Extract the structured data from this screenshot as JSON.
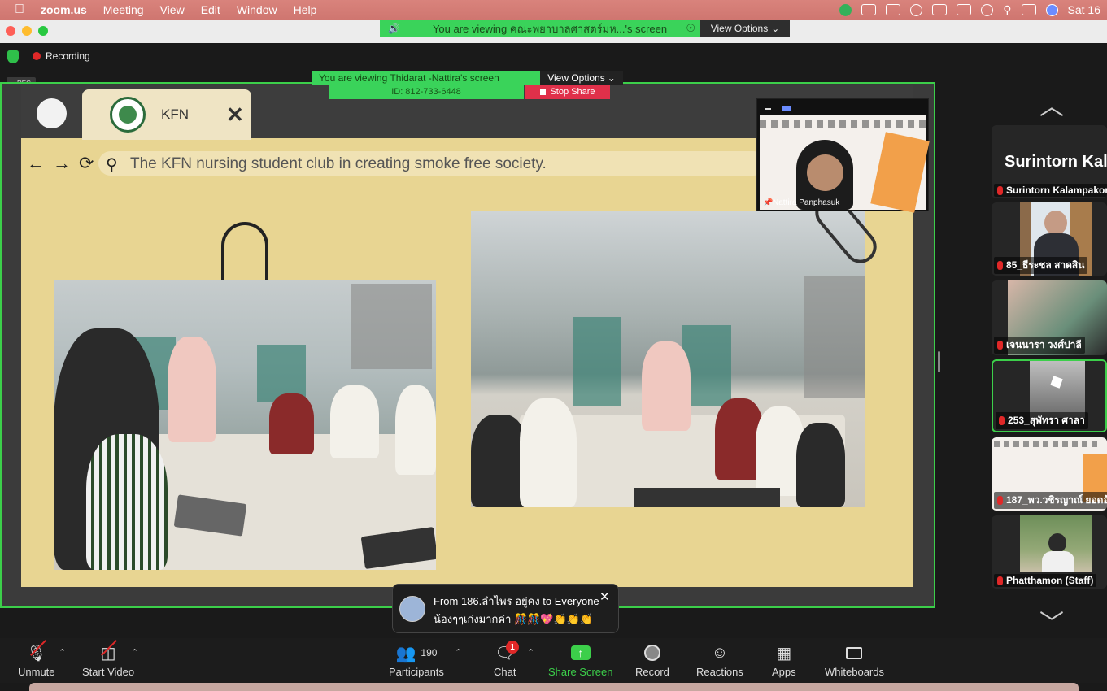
{
  "menubar": {
    "app_name": "zoom.us",
    "items": [
      "Meeting",
      "View",
      "Edit",
      "Window",
      "Help"
    ],
    "clock": "Sat 16"
  },
  "view_banner": {
    "text": "You are viewing คณะพยาบาลศาสตร์มห...'s screen",
    "options_label": "View Options"
  },
  "meeting": {
    "recording_label": "Recording",
    "rec_tag": "REC"
  },
  "shared_screen": {
    "inner_banner": "You are viewing Thidarat -Nattira's screen",
    "inner_options": "View Options",
    "inner_meeting_id": "ID: 812-733-6448",
    "inner_stop_share": "Stop Share",
    "tab_title": "KFN",
    "address_text": "The KFN nursing student club in creating smoke free society."
  },
  "speaker_thumb": {
    "name": "Nattira Panphasuk"
  },
  "participants": {
    "header_name": "Surintorn Kal...",
    "tiles": [
      {
        "name": "Surintorn Kalampakorn"
      },
      {
        "name": "85_ธีระชล สาดสิน"
      },
      {
        "name": "เจนนารา วงศ์ปาลี"
      },
      {
        "name": "253_สุพัทรา ศาลา"
      },
      {
        "name": "187_พว.วชิรญาณ์ ยอดอ้"
      },
      {
        "name": "Phatthamon (Staff)"
      }
    ]
  },
  "chat_popup": {
    "from": "From 186.ลำไพร อยู่คง to Everyone",
    "message": "น้องๆๆเก่งมากค่า 🎊🎊💖👏👏👏"
  },
  "toolbar": {
    "unmute": "Unmute",
    "start_video": "Start Video",
    "participants": "Participants",
    "participant_count": "190",
    "chat": "Chat",
    "chat_badge": "1",
    "share_screen": "Share Screen",
    "record": "Record",
    "reactions": "Reactions",
    "apps": "Apps",
    "whiteboards": "Whiteboards"
  },
  "colors": {
    "accent_green": "#3ccf4a",
    "mute_red": "#e02828",
    "menubar": "#d9837c"
  }
}
